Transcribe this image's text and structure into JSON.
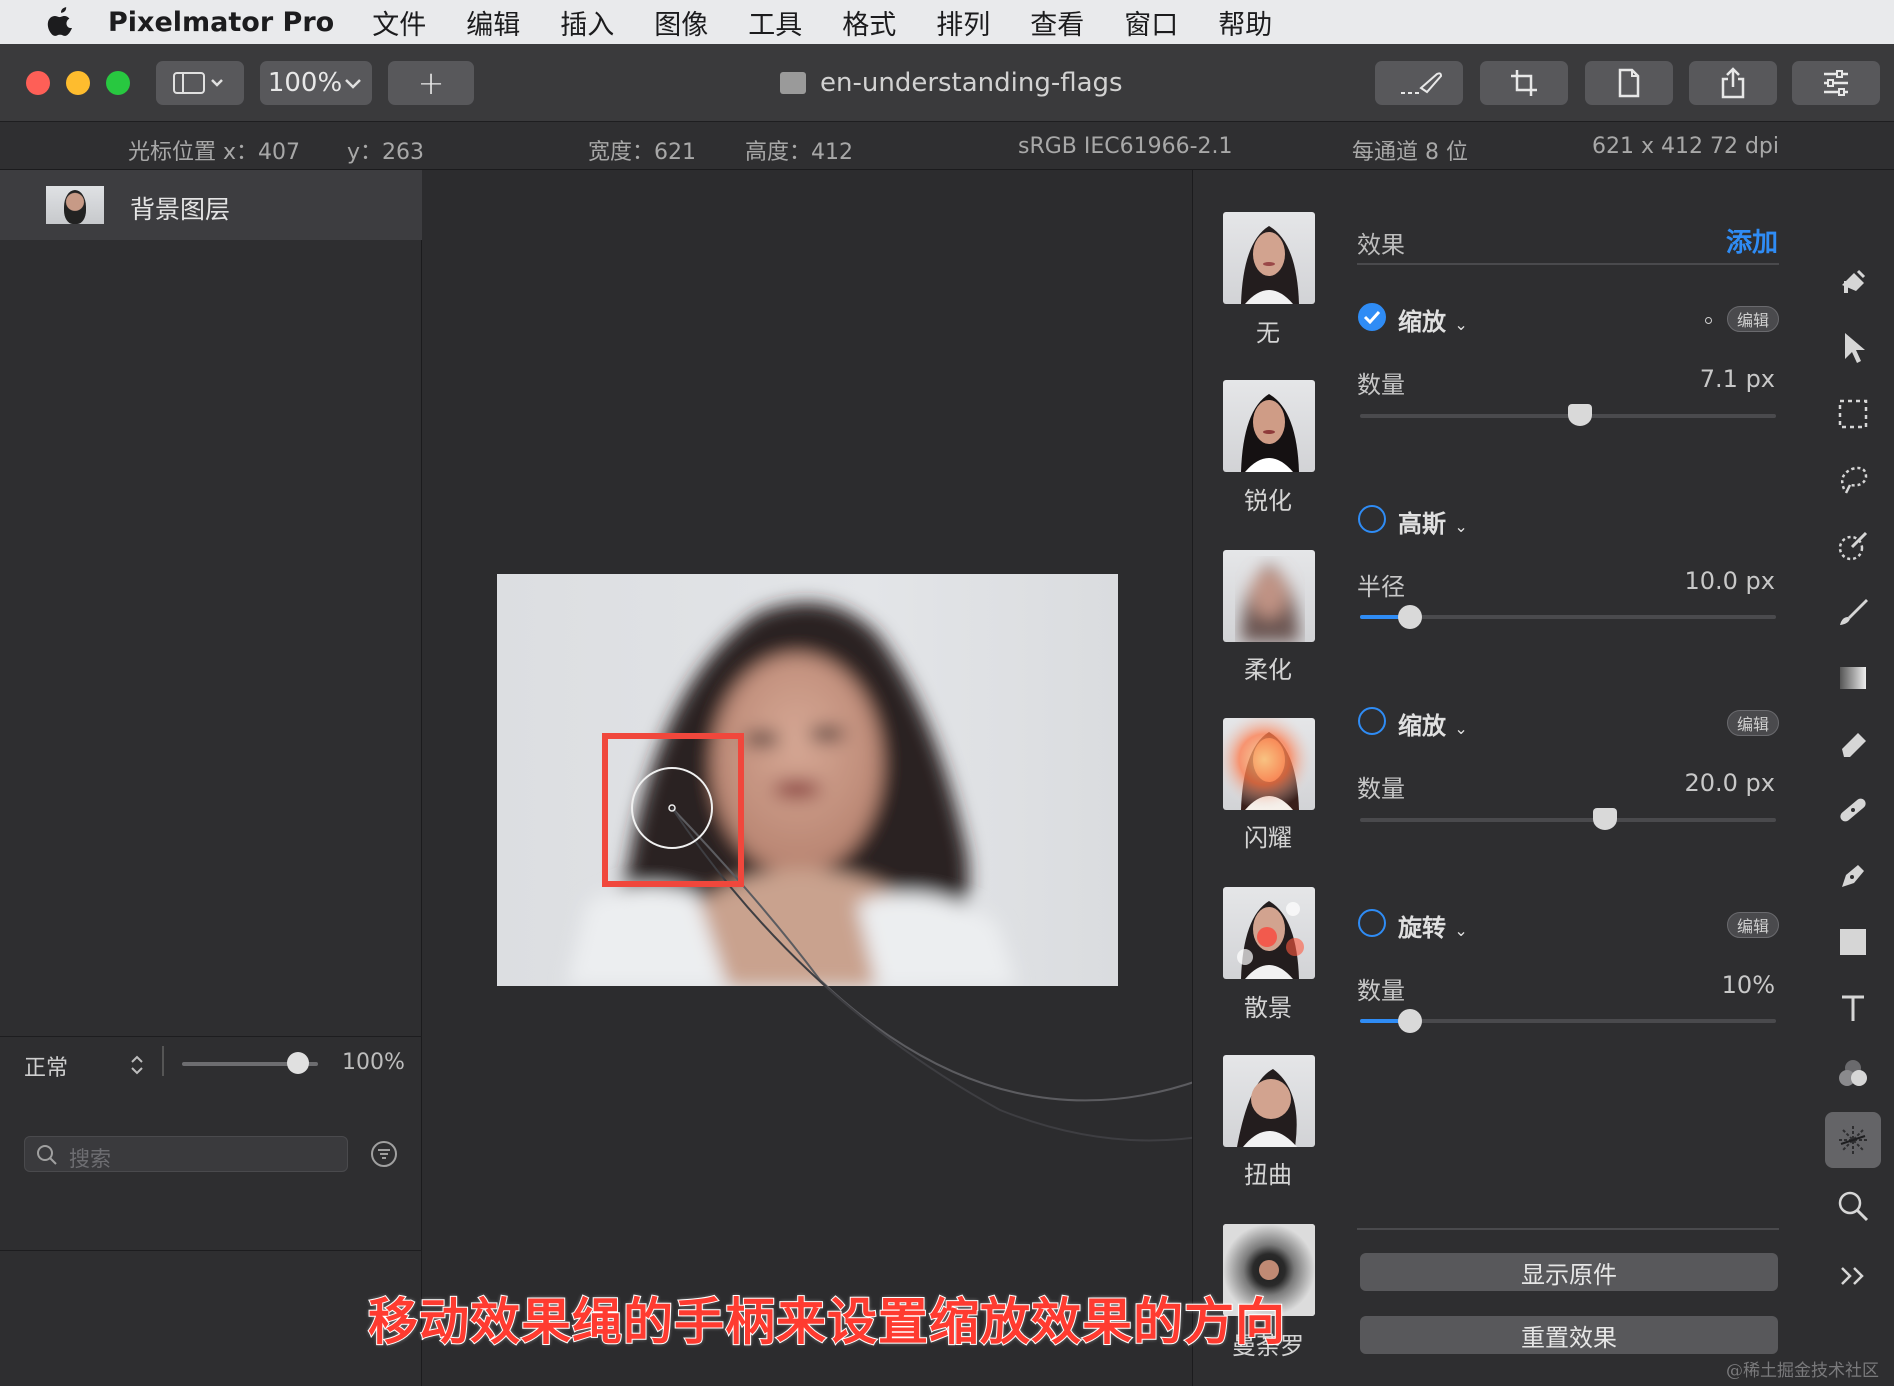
{
  "menubar": {
    "apple_icon": "apple-logo",
    "app_name": "Pixelmator Pro",
    "items": [
      "文件",
      "编辑",
      "插入",
      "图像",
      "工具",
      "格式",
      "排列",
      "查看",
      "窗口",
      "帮助"
    ]
  },
  "toolbar": {
    "zoom": "100%",
    "add_symbol": "+",
    "document_title": "en-understanding-flags"
  },
  "infobar": {
    "cursor_x": "光标位置 x：407",
    "cursor_y": "y：263",
    "width": "宽度：621",
    "height": "高度：412",
    "color_profile": "sRGB IEC61966-2.1",
    "bit_depth": "每通道 8 位",
    "resolution": "621 x 412 72 dpi"
  },
  "layers": {
    "items": [
      {
        "name": "背景图层"
      }
    ],
    "blend_mode": "正常",
    "opacity": "100%",
    "opacity_level": 0.85,
    "search_placeholder": "搜索"
  },
  "browser": {
    "presets": [
      "无",
      "锐化",
      "柔化",
      "闪耀",
      "散景",
      "扭曲",
      "曼荼罗"
    ]
  },
  "effects": {
    "title": "效果",
    "add_label": "添加",
    "edit_label": "编辑",
    "items": [
      {
        "name": "缩放",
        "enabled": true,
        "param": "数量",
        "value": "7.1 px",
        "level": 0.53,
        "has_edit": true
      },
      {
        "name": "高斯",
        "enabled": false,
        "param": "半径",
        "value": "10.0 px",
        "level": 0.12,
        "has_edit": false
      },
      {
        "name": "缩放",
        "enabled": false,
        "param": "数量",
        "value": "20.0 px",
        "level": 0.59,
        "has_edit": true
      },
      {
        "name": "旋转",
        "enabled": false,
        "param": "数量",
        "value": "10%",
        "level": 0.12,
        "has_edit": true
      }
    ],
    "show_original": "显示原件",
    "reset_effects": "重置效果"
  },
  "tools": [
    "paint-bucket-icon",
    "arrow-icon",
    "marquee-icon",
    "lasso-icon",
    "magic-select-icon",
    "brush-icon",
    "gradient-icon",
    "eraser-icon",
    "bandage-icon",
    "pen-icon",
    "shape-icon",
    "text-icon",
    "color-adjust-icon",
    "effects-icon",
    "zoom-icon",
    "more-icon"
  ],
  "caption": "移动效果绳的手柄来设置缩放效果的方向",
  "watermark": "@稀土掘金技术社区",
  "colors": {
    "accent": "#2f8cf5",
    "highlight_box": "#f0473c",
    "caption": "#ff3b30"
  }
}
